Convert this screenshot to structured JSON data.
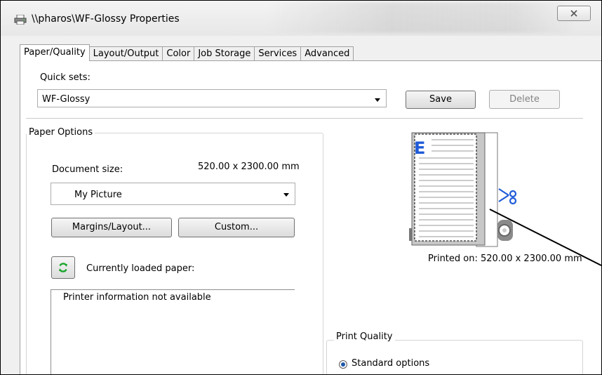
{
  "window": {
    "title": "\\\\pharos\\WF-Glossy Properties"
  },
  "tabs": [
    {
      "label": "Paper/Quality"
    },
    {
      "label": "Layout/Output"
    },
    {
      "label": "Color"
    },
    {
      "label": "Job Storage"
    },
    {
      "label": "Services"
    },
    {
      "label": "Advanced"
    }
  ],
  "quick_sets": {
    "label": "Quick sets:",
    "value": "WF-Glossy",
    "save": "Save",
    "delete": "Delete"
  },
  "paper_options": {
    "title": "Paper Options",
    "document_size_label": "Document size:",
    "document_size_value": "520.00 x 2300.00 mm",
    "size_select": "My Picture",
    "margins_button": "Margins/Layout...",
    "custom_button": "Custom...",
    "loaded_paper_label": "Currently loaded paper:",
    "printer_info": "Printer information not available"
  },
  "preview": {
    "printed_on": "Printed on: 520.00 x 2300.00 mm",
    "corner_letter": "E"
  },
  "print_quality": {
    "title": "Print Quality",
    "option": "Standard options"
  },
  "colors": {
    "accent_blue": "#1e5bd8",
    "refresh_green": "#19a52a"
  }
}
